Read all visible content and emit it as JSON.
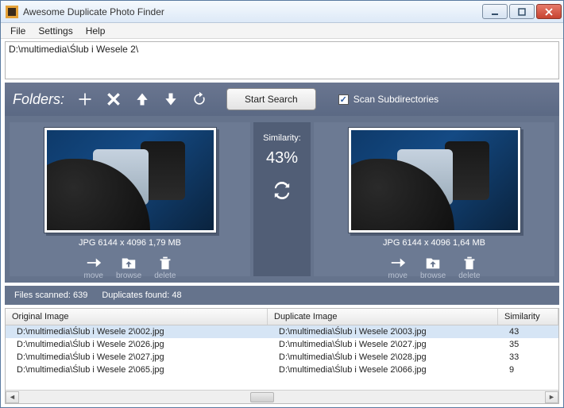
{
  "window": {
    "title": "Awesome Duplicate Photo Finder"
  },
  "menu": {
    "file": "File",
    "settings": "Settings",
    "help": "Help"
  },
  "path_entry": "D:\\multimedia\\Ślub i Wesele 2\\",
  "toolbar": {
    "label": "Folders:",
    "start": "Start Search",
    "scan_sub": "Scan Subdirectories"
  },
  "similarity": {
    "label": "Similarity:",
    "value": "43%"
  },
  "left_image": {
    "meta": "JPG  6144 x 4096  1,79 MB",
    "move": "move",
    "browse": "browse",
    "delete": "delete"
  },
  "right_image": {
    "meta": "JPG  6144 x 4096  1,64 MB",
    "move": "move",
    "browse": "browse",
    "delete": "delete"
  },
  "status": {
    "scanned": "Files scanned: 639",
    "dupes": "Duplicates found: 48"
  },
  "table": {
    "col1": "Original Image",
    "col2": "Duplicate Image",
    "col3": "Similarity",
    "rows": [
      {
        "orig": "D:\\multimedia\\Ślub i Wesele 2\\002.jpg",
        "dup": "D:\\multimedia\\Ślub i Wesele 2\\003.jpg",
        "sim": "43"
      },
      {
        "orig": "D:\\multimedia\\Ślub i Wesele 2\\026.jpg",
        "dup": "D:\\multimedia\\Ślub i Wesele 2\\027.jpg",
        "sim": "35"
      },
      {
        "orig": "D:\\multimedia\\Ślub i Wesele 2\\027.jpg",
        "dup": "D:\\multimedia\\Ślub i Wesele 2\\028.jpg",
        "sim": "33"
      },
      {
        "orig": "D:\\multimedia\\Ślub i Wesele 2\\065.jpg",
        "dup": "D:\\multimedia\\Ślub i Wesele 2\\066.jpg",
        "sim": "9"
      }
    ]
  }
}
